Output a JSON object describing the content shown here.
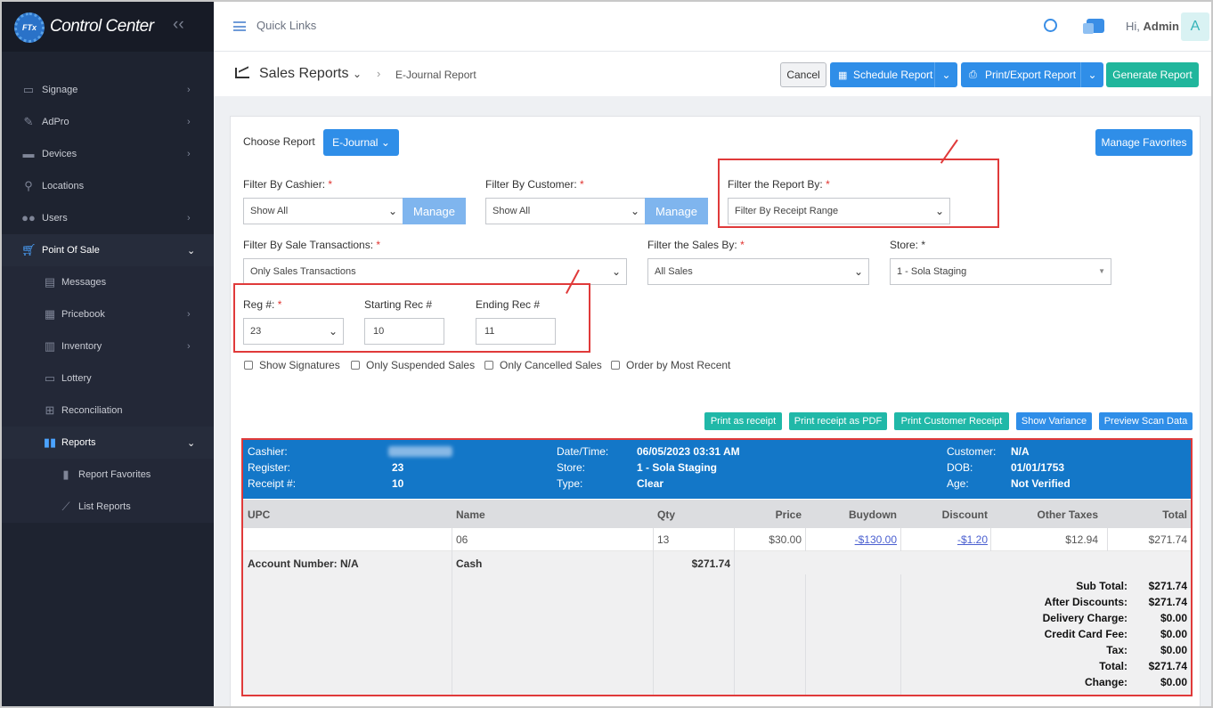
{
  "app": {
    "title": "Control Center",
    "logo_text": "FTx"
  },
  "sidebar": {
    "items": [
      {
        "label": "Signage",
        "icon": "monitor-icon"
      },
      {
        "label": "AdPro",
        "icon": "brush-icon"
      },
      {
        "label": "Devices",
        "icon": "devices-icon"
      },
      {
        "label": "Locations",
        "icon": "map-pin-icon"
      },
      {
        "label": "Users",
        "icon": "users-icon"
      },
      {
        "label": "Point Of Sale",
        "icon": "cart-icon"
      },
      {
        "label": "Messages",
        "icon": "message-icon"
      },
      {
        "label": "Pricebook",
        "icon": "calculator-icon"
      },
      {
        "label": "Inventory",
        "icon": "inventory-icon"
      },
      {
        "label": "Lottery",
        "icon": "ticket-icon"
      },
      {
        "label": "Reconciliation",
        "icon": "grid-icon"
      },
      {
        "label": "Reports",
        "icon": "bar-chart-icon"
      },
      {
        "label": "Report Favorites",
        "icon": "bookmark-icon"
      },
      {
        "label": "List Reports",
        "icon": "line-chart-icon"
      }
    ]
  },
  "topbar": {
    "quick_links": "Quick Links",
    "greeting": "Hi,",
    "user": "Admin",
    "avatar_letter": "A"
  },
  "header": {
    "title": "Sales Reports",
    "breadcrumb": "E-Journal Report",
    "cancel": "Cancel",
    "schedule": "Schedule Report",
    "print_export": "Print/Export Report",
    "generate": "Generate Report"
  },
  "form": {
    "choose_report_label": "Choose Report",
    "choose_report_value": "E-Journal",
    "manage_favorites": "Manage Favorites",
    "cashier_label": "Filter By Cashier:",
    "cashier_value": "Show All",
    "customer_label": "Filter By Customer:",
    "customer_value": "Show All",
    "manage": "Manage",
    "report_by_label": "Filter the Report By:",
    "report_by_value": "Filter By Receipt Range",
    "sale_tx_label": "Filter By Sale Transactions:",
    "sale_tx_value": "Only Sales Transactions",
    "sales_by_label": "Filter the Sales By:",
    "sales_by_value": "All Sales",
    "store_label": "Store: *",
    "store_value": "1 - Sola Staging",
    "reg_label": "Reg #:",
    "reg_value": "23",
    "start_label": "Starting Rec #",
    "start_value": "10",
    "end_label": "Ending Rec #",
    "end_value": "11",
    "checkboxes": [
      "Show Signatures",
      "Only Suspended Sales",
      "Only Cancelled Sales",
      "Order by Most Recent"
    ]
  },
  "actions": [
    "Print as receipt",
    "Print receipt as PDF",
    "Print Customer Receipt",
    "Show Variance",
    "Preview Scan Data"
  ],
  "receipt": {
    "cashier_k": "Cashier:",
    "register_k": "Register:",
    "register_v": "23",
    "receipt_k": "Receipt #:",
    "receipt_v": "10",
    "datetime_k": "Date/Time:",
    "datetime_v": "06/05/2023 03:31 AM",
    "store_k": "Store:",
    "store_v": "1 - Sola Staging",
    "type_k": "Type:",
    "type_v": "Clear",
    "customer_k": "Customer:",
    "customer_v": "N/A",
    "dob_k": "DOB:",
    "dob_v": "01/01/1753",
    "age_k": "Age:",
    "age_v": "Not Verified",
    "columns": [
      "UPC",
      "Name",
      "Qty",
      "Price",
      "Buydown",
      "Discount",
      "Other Taxes",
      "Total"
    ],
    "row": {
      "upc": "",
      "name": "06",
      "qty": "13",
      "price": "$30.00",
      "buydown": "-$130.00",
      "discount": "-$1.20",
      "other_taxes": "$12.94",
      "total": "$271.74"
    },
    "account": "Account Number: N/A",
    "payment_type": "Cash",
    "payment_amount": "$271.74",
    "totals": [
      {
        "label": "Sub Total:",
        "value": "$271.74"
      },
      {
        "label": "After Discounts:",
        "value": "$271.74"
      },
      {
        "label": "Delivery Charge:",
        "value": "$0.00"
      },
      {
        "label": "Credit Card Fee:",
        "value": "$0.00"
      },
      {
        "label": "Tax:",
        "value": "$0.00"
      },
      {
        "label": "Total:",
        "value": "$271.74"
      },
      {
        "label": "Change:",
        "value": "$0.00"
      }
    ]
  },
  "colors": {
    "sidebar_bg": "#1e2330",
    "primary": "#2f8ee8",
    "teal": "#20b8a8",
    "highlight": "#e03a3a",
    "receipt_header": "#1377c8"
  }
}
